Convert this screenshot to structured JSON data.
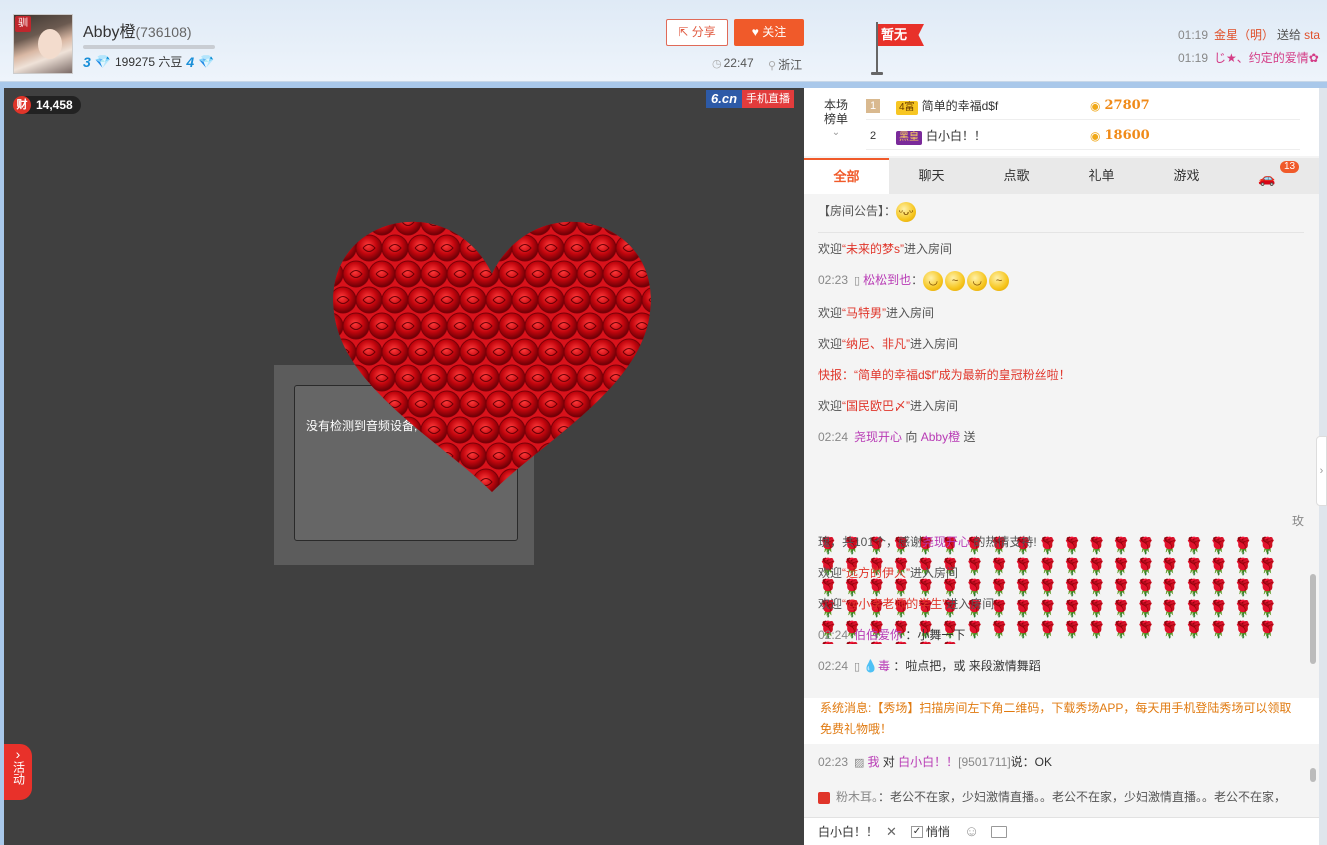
{
  "anchor": {
    "name": "Abby橙",
    "room_id": "(736108)",
    "level_left": "3",
    "beans": "199275 六豆",
    "level_right": "4",
    "avatar_tag": "驯"
  },
  "header": {
    "share_label": "分享",
    "follow_label": "关注",
    "live_time": "22:47",
    "location": "浙江",
    "flag_label": "暂无",
    "tickers": [
      {
        "time": "01:19",
        "user": "金星（明）",
        "verb": "送给",
        "target": "sta"
      },
      {
        "time": "01:19",
        "user": "じ★、约定的爱情✿",
        "verb": "",
        "target": ""
      }
    ]
  },
  "video": {
    "wealth": "14,458",
    "wealth_icon": "财",
    "brand_logo": "6.cn",
    "brand_mobile": "手机直播",
    "audio_msg": "没有检测到音频设备,",
    "activity_label": "活动"
  },
  "rank": {
    "label_top": "本场",
    "label_bottom": "榜单",
    "rows": [
      {
        "num": "1",
        "badge": "4富",
        "name": "简单的幸福d$f",
        "score": "27807"
      },
      {
        "num": "2",
        "badge": "黑皇",
        "name": "白小白！！",
        "score": "18600"
      }
    ]
  },
  "tabs": [
    "全部",
    "聊天",
    "点歌",
    "礼单",
    "游戏"
  ],
  "car_badge": "13",
  "chat": {
    "notice_label": "【房间公告】：",
    "welcome_prefix": "欢迎",
    "enter_suffix": "进入房间",
    "w1": "“未来的梦s”",
    "m1_time": "02:23",
    "m1_user": "松松到也",
    "m1_colon": "：",
    "w2": "“马特男”",
    "w3": "“纳尼、非凡”",
    "news": "快报：“简单的幸福d$f”成为最新的皇冠粉丝啦！",
    "w4": "“国民欧巴〆”",
    "gift_time": "02:24",
    "gift_user": "尧现开心",
    "gift_to": "向",
    "gift_anchor": "Abby橙",
    "gift_verb": "送",
    "gift_tail1": "玫",
    "gift_tail2": "瑰，共101个，感谢",
    "gift_thanks_user": "尧现开心",
    "gift_tail3": "的热情支持!",
    "w5": "“远方的伊人”",
    "w6": "“@小李老师的学生”",
    "m2_time": "02:24",
    "m2_user": "伯伯爱你",
    "m2_text": "：小舞一下",
    "m3_time": "02:24",
    "m3_user": "毒",
    "m3_text": "：啦点把，或 来段激情舞蹈"
  },
  "system": {
    "label": "系统消息:",
    "text": "【秀场】扫描房间左下角二维码，下载秀场APP，每天用手机登陆秀场可以领取免费礼物哦！"
  },
  "private_msg": {
    "time": "02:23",
    "me": "我",
    "to": "对",
    "target": "白小白！！",
    "id": "[9501711]",
    "said": "说：OK"
  },
  "fan_msg": {
    "user": "粉木耳。",
    "text": "：老公不在家，少妇激情直播。。老公不在家，少妇激情直播。。老公不在家，"
  },
  "input": {
    "target": "白小白！！",
    "quiet_label": "悄悄"
  }
}
